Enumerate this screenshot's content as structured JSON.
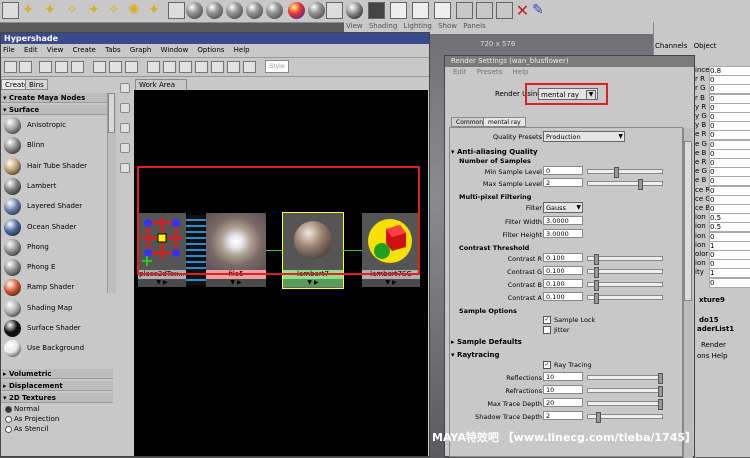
{
  "viewport_menu": [
    "View",
    "Shading",
    "Lighting",
    "Show",
    "Panels"
  ],
  "viewport_label": "720 x 576",
  "channel_box": {
    "header": [
      "Channels",
      "Object"
    ],
    "rows": [
      {
        "label": "ince",
        "value": "0.8"
      },
      {
        "label": "r R",
        "value": "0"
      },
      {
        "label": "r G",
        "value": "0"
      },
      {
        "label": "r B",
        "value": "0"
      },
      {
        "label": "y R",
        "value": "0"
      },
      {
        "label": "y G",
        "value": "0"
      },
      {
        "label": "y B",
        "value": "0"
      },
      {
        "label": "e R",
        "value": "0"
      },
      {
        "label": "e G",
        "value": "0"
      },
      {
        "label": "e B",
        "value": "0"
      },
      {
        "label": "e R",
        "value": "0"
      },
      {
        "label": "e G",
        "value": "0"
      },
      {
        "label": "e B",
        "value": "0"
      },
      {
        "label": "ce R",
        "value": "0"
      },
      {
        "label": "ce G",
        "value": "0"
      },
      {
        "label": "ce B",
        "value": "0"
      },
      {
        "label": "ion",
        "value": "0.5"
      },
      {
        "label": "ion",
        "value": "0.5"
      },
      {
        "label": "ion",
        "value": "0"
      },
      {
        "label": "ion",
        "value": "1"
      },
      {
        "label": "olor",
        "value": "0"
      },
      {
        "label": "ion",
        "value": "0"
      },
      {
        "label": "ity",
        "value": "1"
      },
      {
        "label": "",
        "value": "0"
      }
    ],
    "texture_label": "xture9",
    "shape_label": "do15",
    "list_label": "aderList1",
    "render_label": "Render",
    "menu_label": "ons  Help"
  },
  "hypershade": {
    "title": "Hypershade",
    "menu": [
      "File",
      "Edit",
      "View",
      "Create",
      "Tabs",
      "Graph",
      "Window",
      "Options",
      "Help"
    ],
    "input_placeholder": "Style",
    "tabs": [
      "Create",
      "Bins"
    ],
    "create_header": "Create Maya Nodes",
    "surface_header": "Surface",
    "surface_nodes": [
      {
        "label": "Anisotropic",
        "color": "#a0a0a0"
      },
      {
        "label": "Blinn",
        "color": "#8a8a8a"
      },
      {
        "label": "Hair Tube Shader",
        "color": "#bfa070"
      },
      {
        "label": "Lambert",
        "color": "#7a7a7a"
      },
      {
        "label": "Layered Shader",
        "color": "#6a80b0"
      },
      {
        "label": "Ocean Shader",
        "color": "#4a6aa0"
      },
      {
        "label": "Phong",
        "color": "#909090"
      },
      {
        "label": "Phong E",
        "color": "#8c8c8c"
      },
      {
        "label": "Ramp Shader",
        "color": "#d05a30"
      },
      {
        "label": "Shading Map",
        "color": "#b0b0b0"
      },
      {
        "label": "Surface Shader",
        "color": "#101010"
      },
      {
        "label": "Use Background",
        "color": "#e8e8e8"
      }
    ],
    "volumetric_header": "Volumetric",
    "displacement_header": "Displacement",
    "textures_header": "2D Textures",
    "texture_options": [
      "Normal",
      "As Projection",
      "As Stencil"
    ],
    "work_area_tab": "Work Area",
    "nodes": [
      {
        "name": "place2dTex...",
        "kind": "place2d"
      },
      {
        "name": "file5",
        "kind": "file"
      },
      {
        "name": "lambert7",
        "kind": "lambert"
      },
      {
        "name": "lambert7SG",
        "kind": "sg"
      }
    ]
  },
  "render_settings": {
    "title": "Render Settings (wan_blusflower)",
    "menu": [
      "Edit",
      "Presets",
      "Help"
    ],
    "render_using_label": "Render Using",
    "render_using_value": "mental ray",
    "tabs": [
      "Common",
      "mental ray"
    ],
    "quality_presets_label": "Quality Presets",
    "quality_presets_value": "Production",
    "anti_aliasing_header": "Anti-aliasing Quality",
    "samples_header": "Number of Samples",
    "min_sample_label": "Min Sample Level",
    "min_sample_value": "0",
    "max_sample_label": "Max Sample Level",
    "max_sample_value": "2",
    "filtering_header": "Multi-pixel Filtering",
    "filter_label": "Filter",
    "filter_value": "Gauss",
    "filter_width_label": "Filter Width",
    "filter_width_value": "3.0000",
    "filter_height_label": "Filter Height",
    "filter_height_value": "3.0000",
    "contrast_header": "Contrast Threshold",
    "contrast_r_label": "Contrast R",
    "contrast_r_value": "0.100",
    "contrast_g_label": "Contrast G",
    "contrast_g_value": "0.100",
    "contrast_b_label": "Contrast B",
    "contrast_b_value": "0.100",
    "contrast_a_label": "Contrast A",
    "contrast_a_value": "0.100",
    "sample_options_header": "Sample Options",
    "sample_lock_label": "Sample Lock",
    "jitter_label": "Jitter",
    "sample_defaults_header": "Sample Defaults",
    "raytracing_header": "Raytracing",
    "ray_tracing_label": "Ray Tracing",
    "reflections_label": "Reflections",
    "reflections_value": "10",
    "refractions_label": "Refractions",
    "refractions_value": "10",
    "max_trace_label": "Max Trace Depth",
    "max_trace_value": "20",
    "shadow_trace_label": "Shadow Trace Depth",
    "shadow_trace_value": "2"
  },
  "watermark": "MAYA特效吧 【www.linecg.com/tieba/1745】",
  "colors": {
    "highlight": "#e02020",
    "title_bar": "#3b4a8c"
  }
}
